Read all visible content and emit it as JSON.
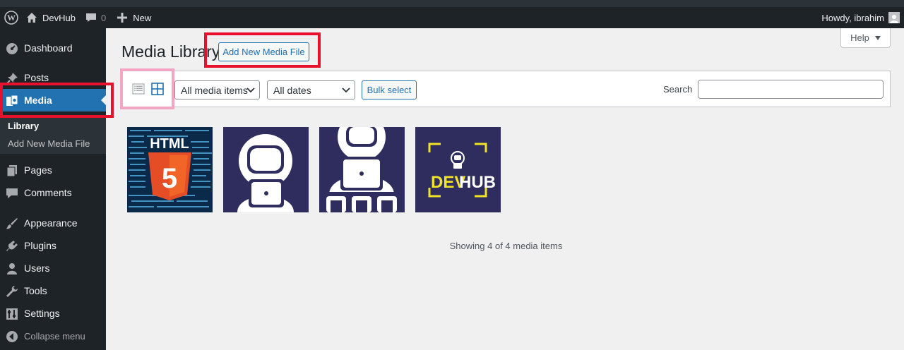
{
  "admin_bar": {
    "site_name": "DevHub",
    "comment_count": "0",
    "new_label": "New",
    "greeting": "Howdy, ibrahim"
  },
  "sidebar": {
    "items": [
      {
        "label": "Dashboard",
        "icon": "dashboard-icon"
      },
      {
        "label": "Posts",
        "icon": "pin-icon"
      },
      {
        "label": "Media",
        "icon": "media-icon",
        "current": true
      },
      {
        "label": "Pages",
        "icon": "pages-icon"
      },
      {
        "label": "Comments",
        "icon": "comment-icon"
      },
      {
        "label": "Appearance",
        "icon": "brush-icon"
      },
      {
        "label": "Plugins",
        "icon": "plugin-icon"
      },
      {
        "label": "Users",
        "icon": "user-icon"
      },
      {
        "label": "Tools",
        "icon": "wrench-icon"
      },
      {
        "label": "Settings",
        "icon": "settings-icon"
      }
    ],
    "submenu": [
      {
        "label": "Library",
        "current": true
      },
      {
        "label": "Add New Media File"
      }
    ],
    "collapse_label": "Collapse menu"
  },
  "page": {
    "title": "Media Library",
    "add_new_label": "Add New Media File",
    "help_label": "Help"
  },
  "toolbar": {
    "filter_type": "All media items",
    "filter_date": "All dates",
    "bulk_select_label": "Bulk select",
    "search_label": "Search",
    "search_value": ""
  },
  "media_items": [
    {
      "name": "html5-code",
      "html_text": "HTML",
      "badge_num": "5"
    },
    {
      "name": "astronaut-laptop"
    },
    {
      "name": "astronaut-full"
    },
    {
      "name": "devhub-logo",
      "logo_text_1": "DEV",
      "logo_text_2": "HUB"
    }
  ],
  "status_text": "Showing 4 of 4 media items",
  "colors": {
    "admin_bg": "#1d2327",
    "accent": "#2271b1",
    "thumb_navy": "#2e2d5e",
    "logo_yellow": "#f0e226",
    "html5_orange": "#e44d26",
    "annotation_red": "#e8112d",
    "annotation_pink": "#f3a6c2"
  }
}
